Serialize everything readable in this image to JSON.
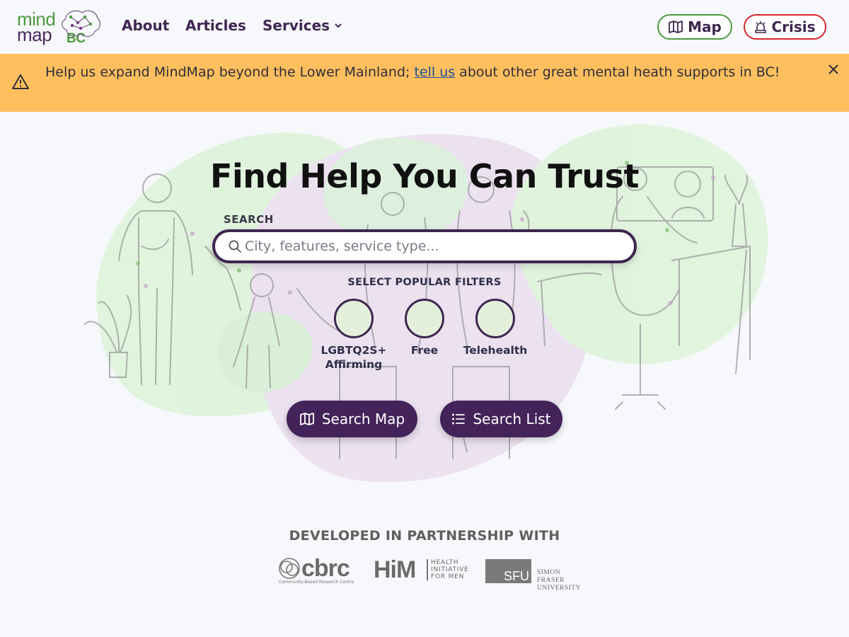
{
  "header": {
    "logo": {
      "line1": "mind",
      "line2": "map",
      "region": "BC"
    },
    "nav": [
      {
        "label": "About"
      },
      {
        "label": "Articles"
      },
      {
        "label": "Services"
      }
    ],
    "map_button": {
      "label": "Map",
      "icon": "map-icon",
      "color": "#4b9a3e"
    },
    "crisis_button": {
      "label": "Crisis",
      "icon": "siren-icon",
      "color": "#d9262a"
    }
  },
  "banner": {
    "text_before": "Help us expand MindMap beyond the Lower Mainland; ",
    "link_text": "tell us",
    "text_after": " about other great mental heath supports in BC!",
    "icon": "warning-icon",
    "close_icon": "close-icon",
    "color": "#ffbf5e"
  },
  "hero": {
    "title": "Find Help You Can Trust",
    "search": {
      "label": "SEARCH",
      "placeholder": "City, features, service type..."
    },
    "filters_title": "SELECT POPULAR FILTERS",
    "filters": [
      {
        "label": "LGBTQ2S+ Affirming"
      },
      {
        "label": "Free"
      },
      {
        "label": "Telehealth"
      }
    ],
    "buttons": {
      "search_map": "Search Map",
      "search_list": "Search List"
    },
    "accent_color": "#43235a"
  },
  "partners": {
    "title": "DEVELOPED IN PARTNERSHIP WITH",
    "logos": [
      {
        "name": "cbrc",
        "subtitle": "Community-Based Research Centre"
      },
      {
        "name": "HiM",
        "subtitle": "HEALTH INITIATIVE FOR MEN"
      },
      {
        "name": "SFU",
        "subtitle": "SIMON FRASER UNIVERSITY"
      }
    ]
  }
}
